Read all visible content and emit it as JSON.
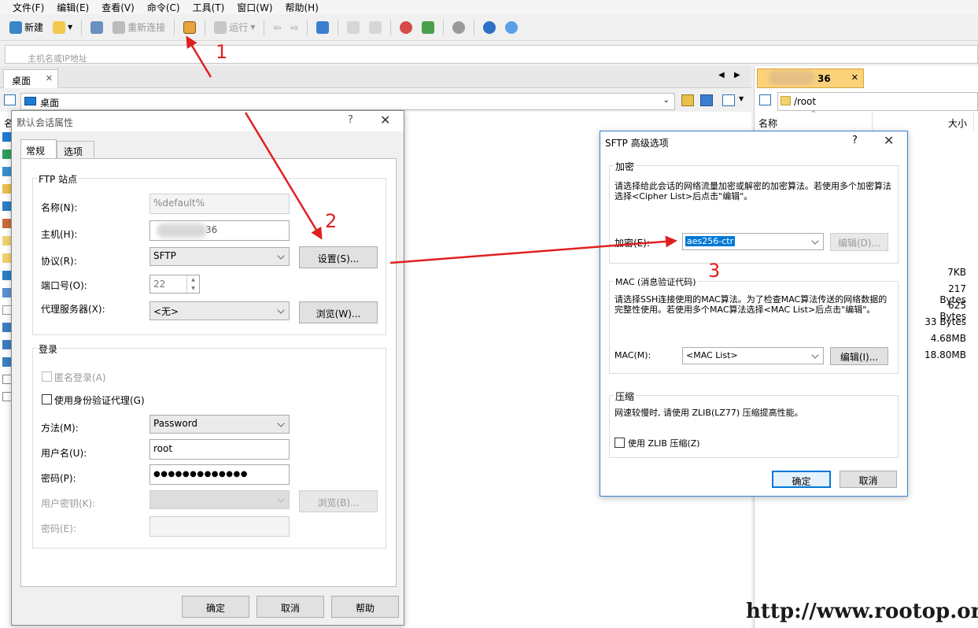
{
  "menu": [
    "文件(F)",
    "编辑(E)",
    "查看(V)",
    "命令(C)",
    "工具(T)",
    "窗口(W)",
    "帮助(H)"
  ],
  "toolbar": {
    "new_label": "新建",
    "reconnect_label": "重新连接",
    "run_label": "运行"
  },
  "address": {
    "placeholder": "主机名或IP地址"
  },
  "left_pane": {
    "tab_label": "桌面",
    "path": "桌面",
    "col_name": "名"
  },
  "right_pane": {
    "tab_label": "36",
    "path": "/root",
    "col_name": "名称",
    "col_size": "大小",
    "sizes": [
      "7KB",
      "217 Bytes",
      "625 Bytes",
      "33 Bytes",
      "4.68MB",
      "18.80MB"
    ]
  },
  "session_dialog": {
    "title": "默认会话属性",
    "help": "?",
    "tab_general": "常规",
    "tab_options": "选项",
    "ftp_group": "FTP 站点",
    "name_label": "名称(N):",
    "name_value": "%default%",
    "host_label": "主机(H):",
    "host_value": "36",
    "protocol_label": "协议(R):",
    "protocol_value": "SFTP",
    "settings_button": "设置(S)...",
    "port_label": "端口号(O):",
    "port_value": "22",
    "proxy_label": "代理服务器(X):",
    "proxy_value": "<无>",
    "browse_button": "浏览(W)...",
    "login_group": "登录",
    "anonymous_label": "匿名登录(A)",
    "agent_label": "使用身份验证代理(G)",
    "method_label": "方法(M):",
    "method_value": "Password",
    "username_label": "用户名(U):",
    "username_value": "root",
    "password_label": "密码(P):",
    "password_value": "●●●●●●●●●●●●●",
    "key_label": "用户密钥(K):",
    "key_browse_button": "浏览(B)...",
    "passphrase_label": "密码(E):",
    "ok": "确定",
    "cancel": "取消",
    "help_button": "帮助"
  },
  "sftp_dialog": {
    "title": "SFTP 高级选项",
    "help": "?",
    "enc_group": "加密",
    "enc_desc": "请选择给此会话的网络流量加密或解密的加密算法。若使用多个加密算法选择<Cipher List>后点击\"编辑\"。",
    "enc_label": "加密(E):",
    "enc_value": "aes256-ctr",
    "enc_edit": "编辑(D)...",
    "mac_group": "MAC (消息验证代码)",
    "mac_desc": "请选择SSH连接使用的MAC算法。为了检查MAC算法传送的网络数据的完整性使用。若使用多个MAC算法选择<MAC List>后点击\"编辑\"。",
    "mac_label": "MAC(M):",
    "mac_value": "<MAC List>",
    "mac_edit": "编辑(I)...",
    "comp_group": "压缩",
    "comp_desc": "网速较慢时, 请使用 ZLIB(LZ77) 压缩提高性能。",
    "zlib_label": "使用 ZLIB 压缩(Z)",
    "ok": "确定",
    "cancel": "取消"
  },
  "annotations": [
    "1",
    "2",
    "3"
  ],
  "watermark": "http://www.rootop.org",
  "colors": {
    "accent": "#0078d7",
    "annotation": "#e02020",
    "tab_active": "#fbd27a"
  }
}
